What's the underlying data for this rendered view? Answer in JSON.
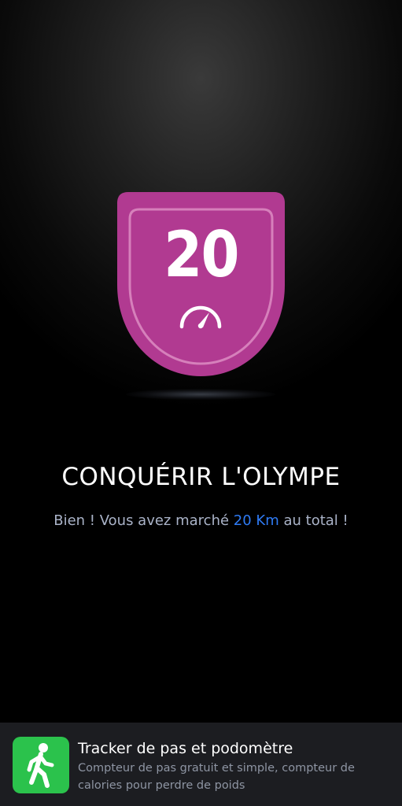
{
  "badge": {
    "value": "20",
    "icon": "speedometer-icon",
    "color": "#b13a91",
    "border_color": "#d07bb6"
  },
  "achievement": {
    "title": "CONQUÉRIR L'OLYMPE",
    "message_prefix": "Bien ! Vous avez marché ",
    "message_highlight": "20 Km",
    "message_suffix": " au total !",
    "highlight_color": "#2f7bf5"
  },
  "ad": {
    "icon": "walking-person-icon",
    "icon_color": "#2bc24c",
    "title": "Tracker de pas et podomètre",
    "description": "Compteur de pas gratuit et simple, compteur de calories pour perdre de poids"
  }
}
